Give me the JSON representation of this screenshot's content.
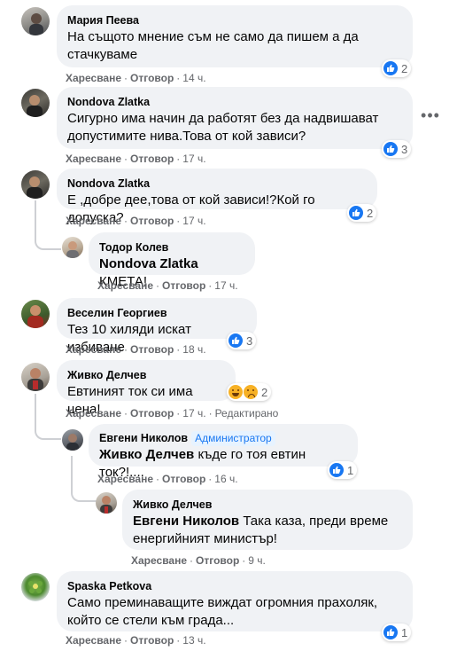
{
  "actions": {
    "like": "Харесване",
    "reply": "Отговор",
    "edited": "Редактирано"
  },
  "comments": [
    {
      "author": "Мария Пеева",
      "text": "На същото мнение съм не само да пишем а да стачкуваме",
      "time": "14 ч.",
      "reactions": {
        "icons": [
          "like-icon"
        ],
        "count": "2"
      }
    },
    {
      "author": "Nondova Zlatka",
      "text": "Сигурно има начин да работят без да надвишават допустимите нива.Това от кой зависи?",
      "time": "17 ч.",
      "reactions": {
        "icons": [
          "like-icon"
        ],
        "count": "3"
      }
    },
    {
      "author": "Nondova Zlatka",
      "text": "Е ,добре дее,това от кой зависи!?Кой го допуска?",
      "time": "17 ч.",
      "reactions": {
        "icons": [
          "like-icon"
        ],
        "count": "2"
      },
      "replies": [
        {
          "author": "Тодор Колев",
          "mention": "Nondova Zlatka",
          "text": "КМЕТА!",
          "time": "17 ч."
        }
      ]
    },
    {
      "author": "Веселин Георгиев",
      "text": "Тез 10 хиляди искат избиване",
      "time": "18 ч.",
      "reactions": {
        "icons": [
          "like-icon"
        ],
        "count": "3"
      }
    },
    {
      "author": "Живко Делчев",
      "text": "Евтиният ток си има цена!",
      "time": "17 ч.",
      "edited": true,
      "reactions": {
        "icons": [
          "haha-icon",
          "sad-icon"
        ],
        "count": "2"
      },
      "replies": [
        {
          "author": "Евгени Николов",
          "badge": "Администратор",
          "mention": "Живко Делчев",
          "text": "къде го тоя евтин ток?!....",
          "time": "16 ч.",
          "reactions": {
            "icons": [
              "like-icon"
            ],
            "count": "1"
          }
        },
        {
          "author": "Живко Делчев",
          "mention": "Евгени Николов",
          "text_line1": "Така каза, преди време",
          "text_line2": "енергийният министър!",
          "time": "9 ч."
        }
      ]
    },
    {
      "author": "Spaska Petkova",
      "text": "Само преминаващите виждат огромния прахоляк, който се стели към града...",
      "time": "13 ч.",
      "reactions": {
        "icons": [
          "like-icon"
        ],
        "count": "1"
      }
    }
  ]
}
